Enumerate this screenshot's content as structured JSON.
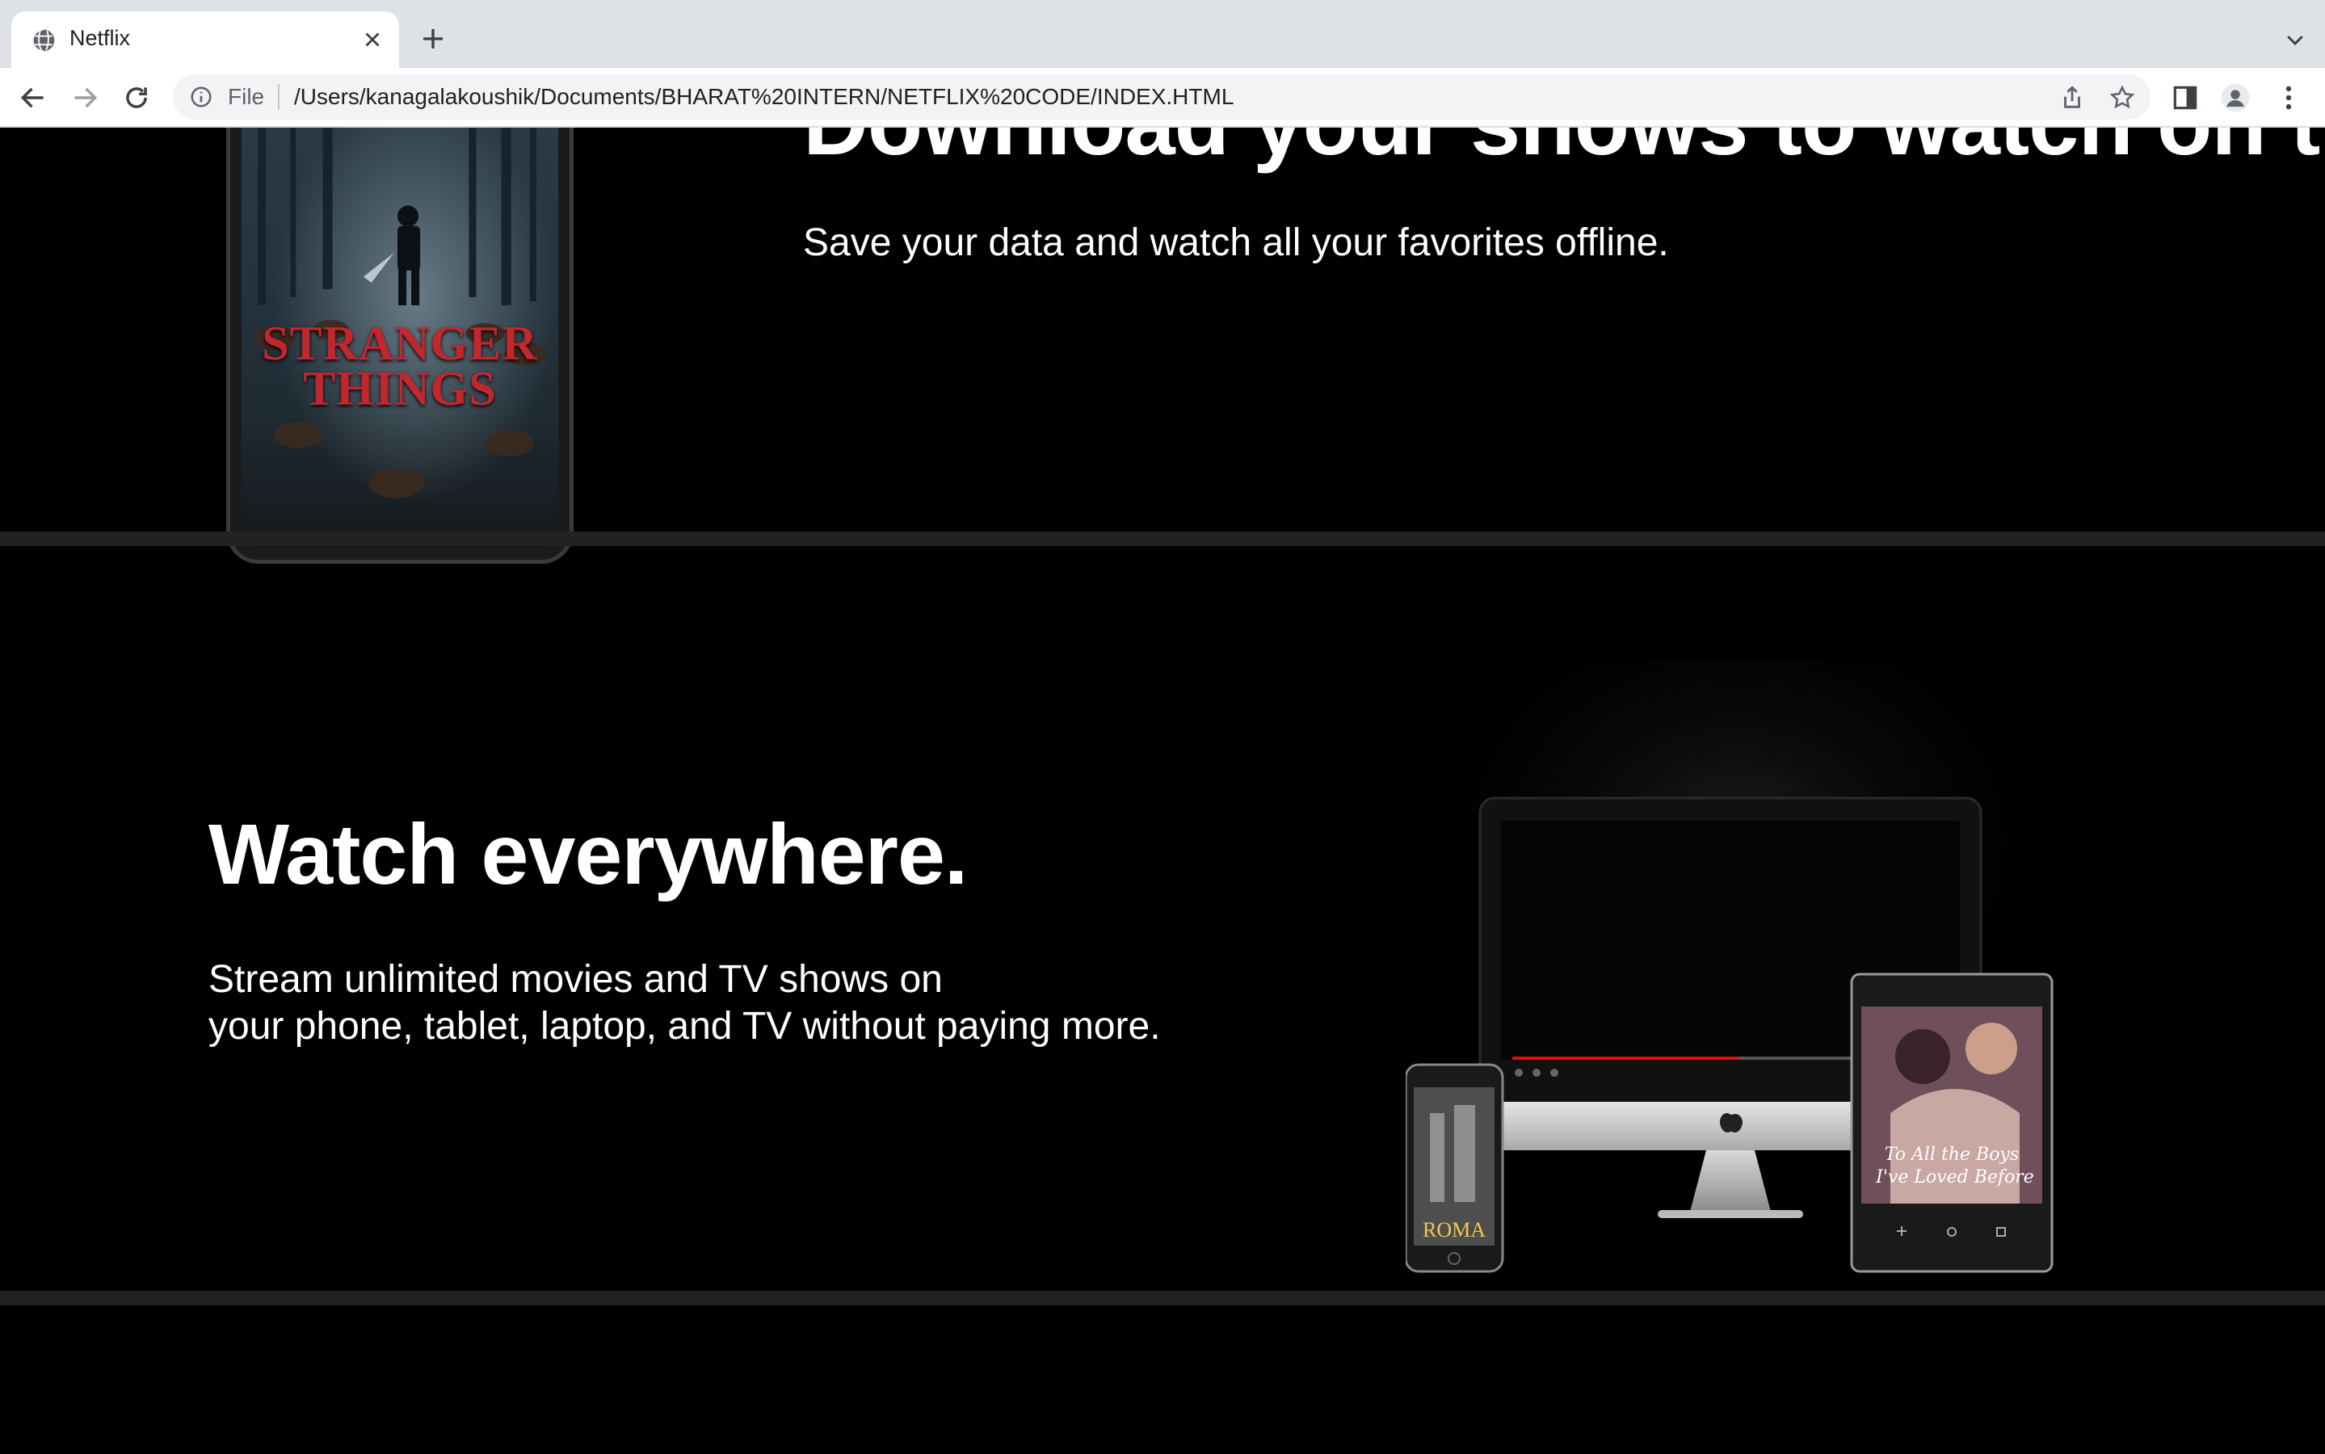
{
  "browser": {
    "tab_title": "Netflix",
    "url_scheme": "File",
    "url": "/Users/kanagalakoushik/Documents/BHARAT%20INTERN/NETFLIX%20CODE/INDEX.HTML"
  },
  "section_download": {
    "heading": "Download your shows to watch on the go.",
    "subheading": "Save your data and watch all your favorites offline.",
    "poster_title_line1": "STRANGER",
    "poster_title_line2": "THINGS"
  },
  "section_watch": {
    "heading": "Watch everywhere.",
    "subheading_line1": "Stream unlimited movies and TV shows on",
    "subheading_line2": "your phone, tablet, laptop, and TV without paying more.",
    "phone_poster_title": "ROMA",
    "tablet_poster_title_line1": "To All the Boys",
    "tablet_poster_title_line2": "I've Loved Before"
  },
  "colors": {
    "background": "#000000",
    "divider": "#222222",
    "netflix_red": "#e50914"
  }
}
